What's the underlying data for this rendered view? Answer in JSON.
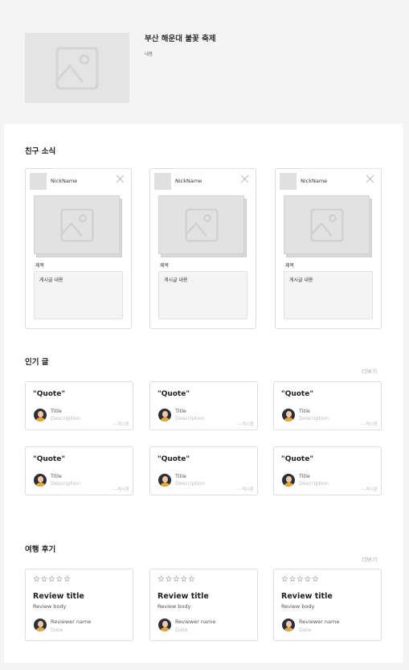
{
  "hero": {
    "image_icon": "image-placeholder-icon",
    "title": "부산 해운대 불꽃 축제",
    "subtitle": "내용"
  },
  "friends": {
    "title": "친구 소식",
    "cards": [
      {
        "nickname": "NickName",
        "post_title": "제목",
        "post_body": "게시글 내용"
      },
      {
        "nickname": "NickName",
        "post_title": "제목",
        "post_body": "게시글 내용"
      },
      {
        "nickname": "NickName",
        "post_title": "제목",
        "post_body": "게시글 내용"
      }
    ]
  },
  "popular": {
    "title": "인기 글",
    "more": "더보기",
    "cards": [
      {
        "quote": "\"Quote\"",
        "title": "Title",
        "description": "Description",
        "board": "---게시판"
      },
      {
        "quote": "\"Quote\"",
        "title": "Title",
        "description": "Description",
        "board": "---게시판"
      },
      {
        "quote": "\"Quote\"",
        "title": "Title",
        "description": "Description",
        "board": "---게시판"
      },
      {
        "quote": "\"Quote\"",
        "title": "Title",
        "description": "Description",
        "board": "---게시판"
      },
      {
        "quote": "\"Quote\"",
        "title": "Title",
        "description": "Description",
        "board": "---게시판"
      },
      {
        "quote": "\"Quote\"",
        "title": "Title",
        "description": "Description",
        "board": "---게시판"
      }
    ]
  },
  "reviews": {
    "title": "여행 후기",
    "more": "더보기",
    "cards": [
      {
        "stars": "☆☆☆☆☆",
        "title": "Review title",
        "body": "Review body",
        "reviewer": "Reviewer name",
        "date": "Date"
      },
      {
        "stars": "☆☆☆☆☆",
        "title": "Review title",
        "body": "Review body",
        "reviewer": "Reviewer name",
        "date": "Date"
      },
      {
        "stars": "☆☆☆☆☆",
        "title": "Review title",
        "body": "Review body",
        "reviewer": "Reviewer name",
        "date": "Date"
      }
    ]
  },
  "colors": {
    "background": "#f4f4f4",
    "panel": "#ffffff",
    "placeholder": "#e2e2e2",
    "muted_text": "#bbbbbb"
  }
}
